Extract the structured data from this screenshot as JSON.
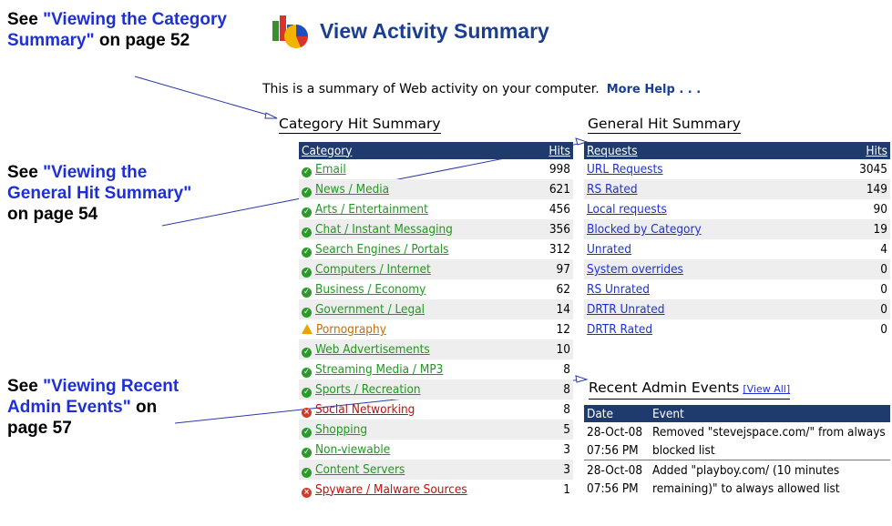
{
  "callouts": [
    {
      "pre": "See ",
      "link": "\"Viewing the Category Summary\"",
      "post": " on page 52"
    },
    {
      "pre": "See ",
      "link": "\"Viewing the General Hit Summary\"",
      "post": " on page 54"
    },
    {
      "pre": "See ",
      "link": "\"Viewing Recent Admin Events\"",
      "post": " on page 57"
    }
  ],
  "header": {
    "title": "View Activity Summary",
    "icon": "activity-chart-icon"
  },
  "intro": {
    "text": "This is a summary of Web activity on your computer.",
    "help": "More Help . . ."
  },
  "category_summary": {
    "title": "Category Hit Summary",
    "col_category": "Category",
    "col_hits": "Hits",
    "rows": [
      {
        "name": "Email",
        "hits": "998",
        "status": "ok"
      },
      {
        "name": "News / Media",
        "hits": "621",
        "status": "ok"
      },
      {
        "name": "Arts / Entertainment",
        "hits": "456",
        "status": "ok"
      },
      {
        "name": "Chat / Instant Messaging",
        "hits": "356",
        "status": "ok"
      },
      {
        "name": "Search Engines / Portals",
        "hits": "312",
        "status": "ok"
      },
      {
        "name": "Computers / Internet",
        "hits": "97",
        "status": "ok"
      },
      {
        "name": "Business / Economy",
        "hits": "62",
        "status": "ok"
      },
      {
        "name": "Government / Legal",
        "hits": "14",
        "status": "ok"
      },
      {
        "name": "Pornography",
        "hits": "12",
        "status": "warn"
      },
      {
        "name": "Web Advertisements",
        "hits": "10",
        "status": "ok"
      },
      {
        "name": "Streaming Media / MP3",
        "hits": "8",
        "status": "ok"
      },
      {
        "name": "Sports / Recreation",
        "hits": "8",
        "status": "ok"
      },
      {
        "name": "Social Networking",
        "hits": "8",
        "status": "block"
      },
      {
        "name": "Shopping",
        "hits": "5",
        "status": "ok"
      },
      {
        "name": "Non-viewable",
        "hits": "3",
        "status": "ok"
      },
      {
        "name": "Content Servers",
        "hits": "3",
        "status": "ok"
      },
      {
        "name": "Spyware / Malware Sources",
        "hits": "1",
        "status": "block"
      }
    ]
  },
  "general_summary": {
    "title": "General Hit Summary",
    "col_requests": "Requests",
    "col_hits": "Hits",
    "rows": [
      {
        "name": "URL Requests",
        "hits": "3045"
      },
      {
        "name": "RS Rated",
        "hits": "149"
      },
      {
        "name": "Local requests",
        "hits": "90"
      },
      {
        "name": "Blocked by Category",
        "hits": "19"
      },
      {
        "name": "Unrated",
        "hits": "4"
      },
      {
        "name": "System overrides",
        "hits": "0"
      },
      {
        "name": "RS Unrated",
        "hits": "0"
      },
      {
        "name": "DRTR Unrated",
        "hits": "0"
      },
      {
        "name": "DRTR Rated",
        "hits": "0"
      }
    ]
  },
  "admin_events": {
    "title": "Recent Admin Events",
    "view_all": "[View All]",
    "col_date": "Date",
    "col_event": "Event",
    "rows": [
      {
        "date": "28-Oct-08 07:56 PM",
        "event": "Removed \"stevejspace.com/\" from always blocked list"
      },
      {
        "date": "28-Oct-08 07:56 PM",
        "event": "Added \"playboy.com/ (10 minutes remaining)\" to always allowed list"
      }
    ]
  },
  "colors": {
    "header_bar": "#1f3b6e",
    "link_blue": "#1f2fd6",
    "allowed_green": "#1f9a1f",
    "blocked_red": "#bb1111",
    "warning_orange": "#cc6a00"
  }
}
